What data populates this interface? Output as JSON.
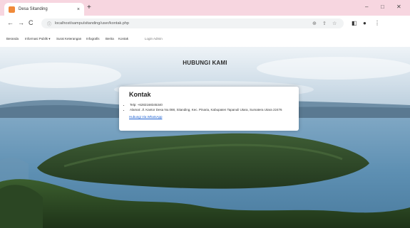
{
  "browser": {
    "tab_title": "Desa Sitanding",
    "tab_close": "×",
    "new_tab": "+",
    "window_controls": {
      "minimize": "–",
      "restore": "□",
      "close": "✕"
    },
    "nav": {
      "back": "←",
      "forward": "→",
      "reload": "C"
    },
    "url": "localhost/sampu/sitanding/user/kontak.php",
    "icons": [
      "info-icon",
      "zoom-icon",
      "share-icon",
      "star-icon",
      "extension-icon",
      "profile-icon",
      "menu-icon"
    ]
  },
  "site_nav": {
    "items": [
      "Beranda",
      "Informasi Publik ▾",
      "Surat Keterangan",
      "Infografis",
      "Berita",
      "Kontak"
    ],
    "login": "Login Admin"
  },
  "page": {
    "heading": "HUBUNGI KAMI"
  },
  "contact": {
    "title": "Kontak",
    "items": [
      "Telp: +6282168345340",
      "Alamat: Jl. Kantor Desa No.088, Sitanding, Kec. Pinaria, Kabupaten Tapanuli Utara, Sumatera Utara 22476"
    ],
    "whatsapp_link": "Hubungi Via WhatsApp"
  },
  "colors": {
    "tabbar": "#f7d6e0",
    "favicon": "#f08a3a",
    "link": "#1a5fd1",
    "sky": "#cfe1ef",
    "lake": "#5d8fb2",
    "island": "#2f4a2a"
  }
}
